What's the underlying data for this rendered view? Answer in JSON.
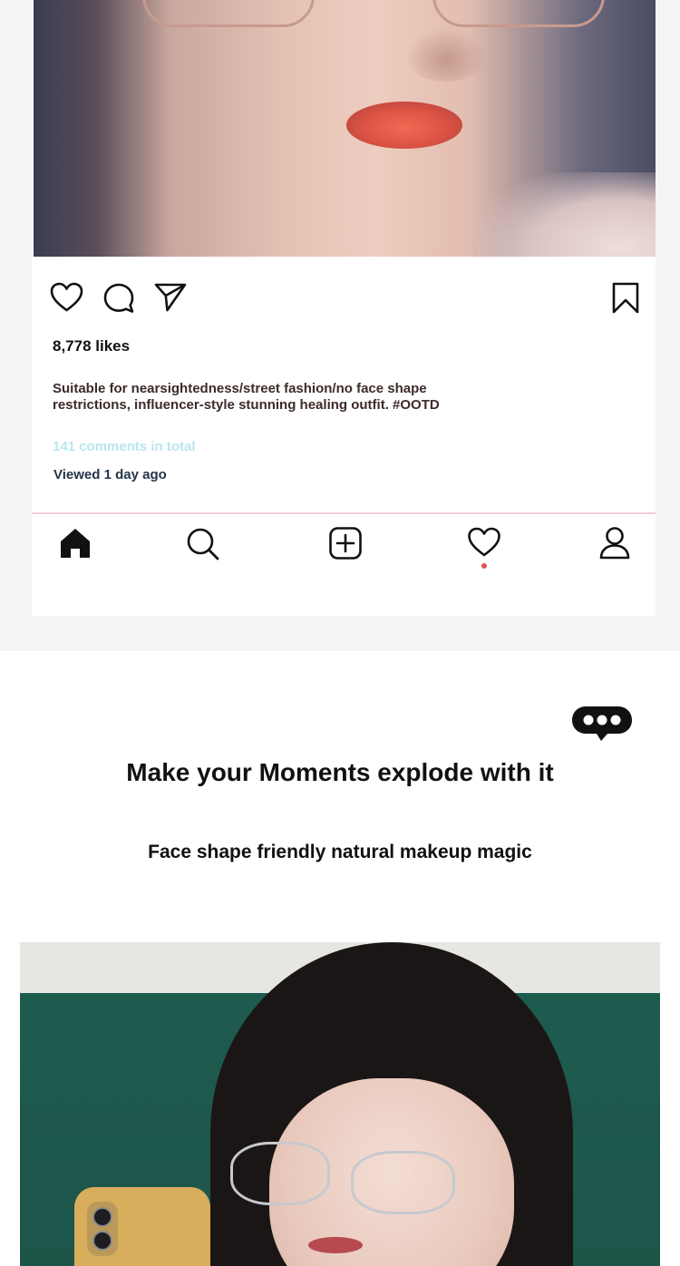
{
  "post": {
    "likes": "8,778 likes",
    "caption": "Suitable for nearsightedness/street fashion/no face shape restrictions, influencer-style stunning healing outfit. #OOTD",
    "comments": "141 comments in total",
    "viewed": "Viewed 1 day ago",
    "actions": {
      "like_icon": "heart-outline-icon",
      "comment_icon": "comment-bubble-icon",
      "share_icon": "paper-plane-icon",
      "save_icon": "bookmark-icon"
    }
  },
  "bottom_nav": {
    "items": [
      {
        "name": "home",
        "icon": "home-icon"
      },
      {
        "name": "search",
        "icon": "search-icon"
      },
      {
        "name": "create",
        "icon": "plus-square-icon"
      },
      {
        "name": "activity",
        "icon": "heart-icon",
        "notification_dot": true
      },
      {
        "name": "profile",
        "icon": "person-icon"
      }
    ]
  },
  "promo": {
    "bubble_icon": "chat-bubble-ellipsis-icon",
    "headline": "Make your Moments explode with it",
    "subhead": "Face shape friendly natural makeup magic"
  },
  "colors": {
    "page_background": "#f4f4f4",
    "comments_text": "#b9e6ef",
    "viewed_text": "#243447",
    "divider": "#efcfd3",
    "notification_dot": "#e05252",
    "chalkboard_green": "#1e5b4f"
  }
}
